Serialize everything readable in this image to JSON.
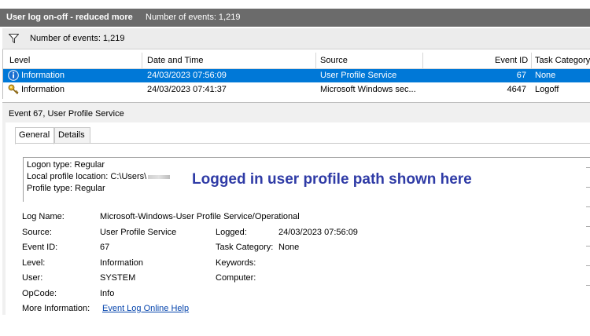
{
  "title_bar": {
    "title": "User log on-off - reduced more",
    "count": "Number of events: 1,219"
  },
  "filter_bar": {
    "label": "Number of events: 1,219"
  },
  "columns": [
    "Level",
    "Date and Time",
    "Source",
    "Event ID",
    "Task Category"
  ],
  "rows": [
    {
      "level": "Information",
      "datetime": "24/03/2023 07:56:09",
      "source": "User Profile Service",
      "event_id": "67",
      "category": "None",
      "icon": "info-icon",
      "selected": true
    },
    {
      "level": "Information",
      "datetime": "24/03/2023 07:41:37",
      "source": "Microsoft Windows sec...",
      "event_id": "4647",
      "category": "Logoff",
      "icon": "key-icon",
      "selected": false
    }
  ],
  "detail": {
    "title": "Event 67, User Profile Service",
    "tabs": [
      "General",
      "Details"
    ],
    "description": {
      "logon_type": "Logon type: Regular",
      "profile_location": "Local profile location: C:\\Users\\",
      "profile_type": "Profile type: Regular"
    },
    "annotation": "Logged in user profile path shown here",
    "properties": {
      "log_name_label": "Log Name:",
      "log_name": "Microsoft-Windows-User Profile Service/Operational",
      "source_label": "Source:",
      "source": "User Profile Service",
      "logged_label": "Logged:",
      "logged": "24/03/2023 07:56:09",
      "event_id_label": "Event ID:",
      "event_id": "67",
      "task_category_label": "Task Category:",
      "task_category": "None",
      "level_label": "Level:",
      "level": "Information",
      "keywords_label": "Keywords:",
      "user_label": "User:",
      "user": "SYSTEM",
      "computer_label": "Computer:",
      "opcode_label": "OpCode:",
      "opcode": "Info",
      "more_info_label": "More Information:",
      "more_info_link": "Event Log Online Help"
    }
  },
  "colors": {
    "title_band": "#6b6b6b",
    "selection": "#0078d7",
    "annotation": "#2f3ba6",
    "link": "#0645ad"
  }
}
